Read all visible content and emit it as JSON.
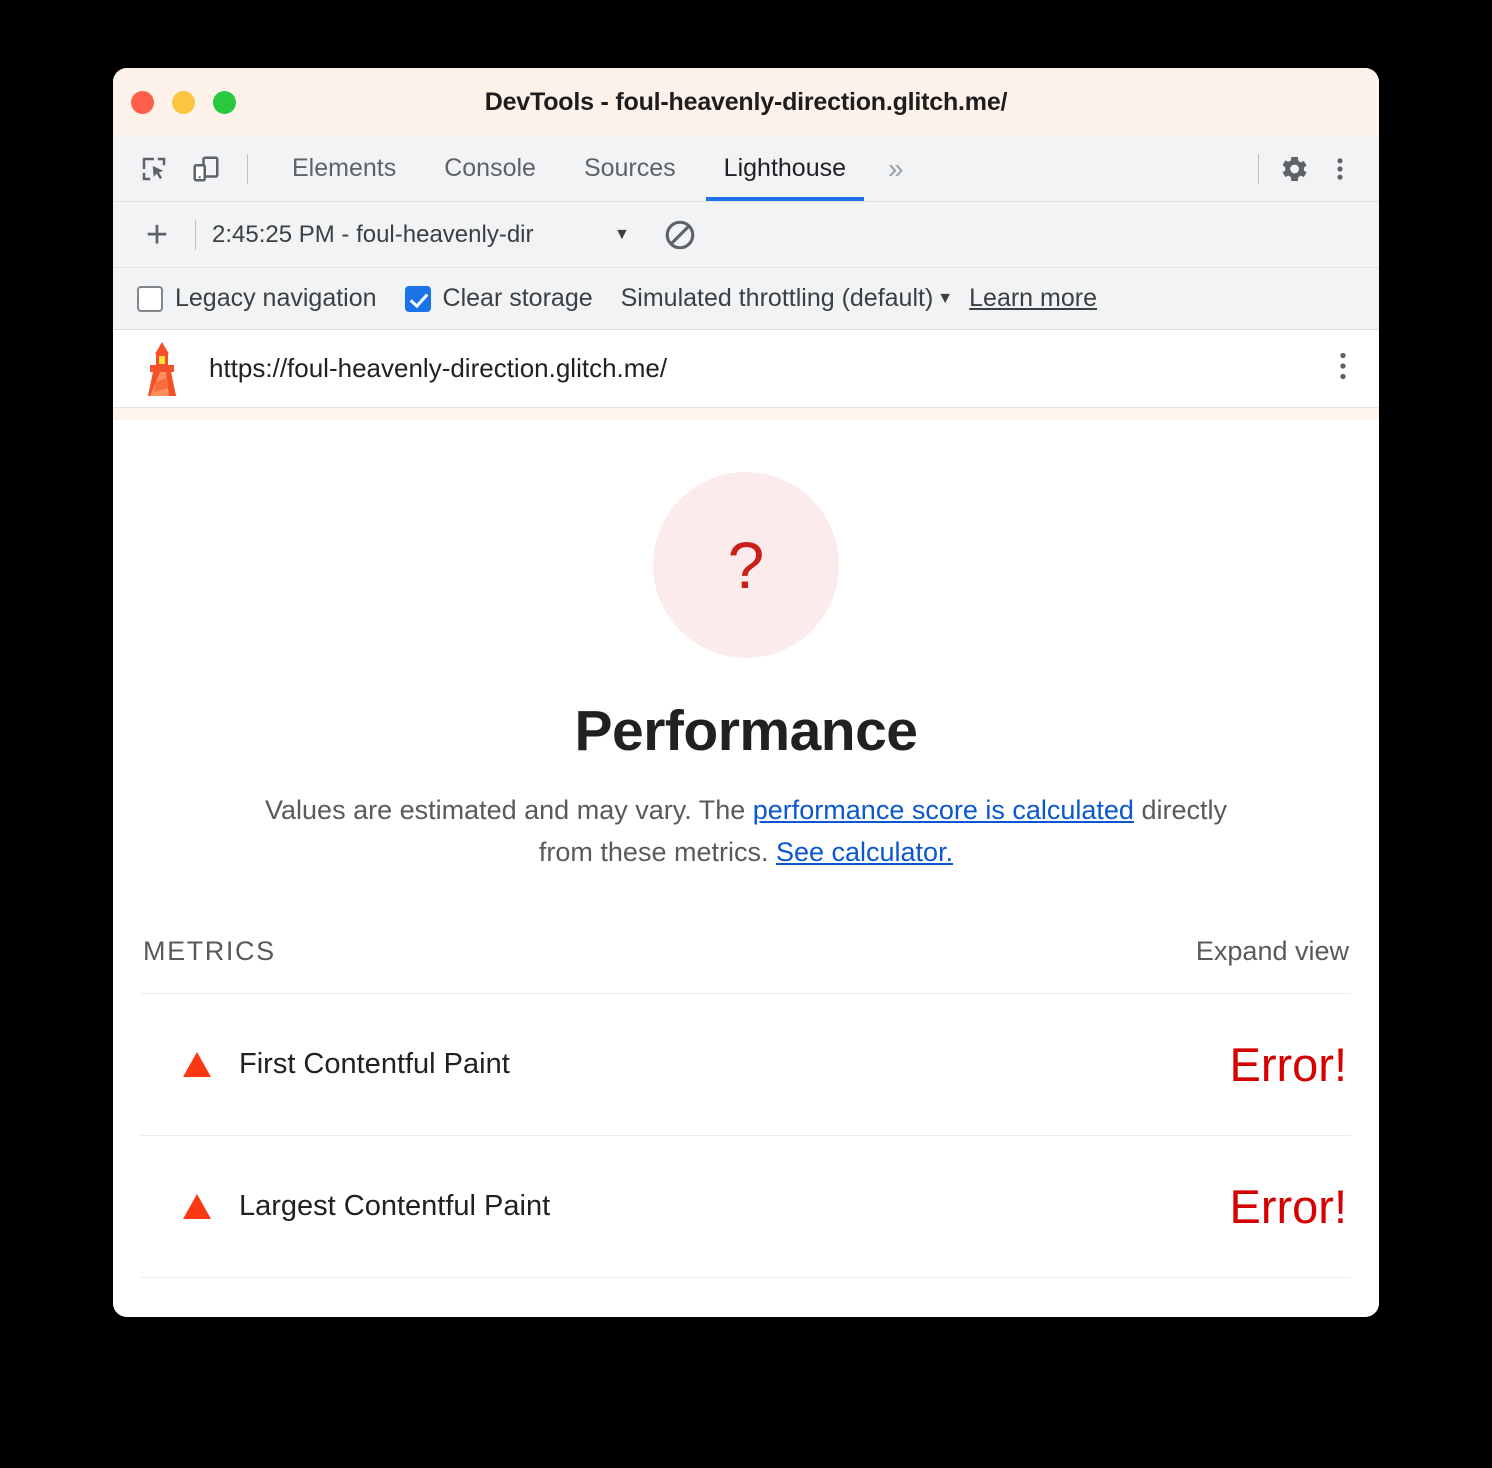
{
  "window": {
    "title": "DevTools - foul-heavenly-direction.glitch.me/",
    "traffic_lights": [
      {
        "name": "close",
        "color": "#ff5f48"
      },
      {
        "name": "minimize",
        "color": "#fcc53f"
      },
      {
        "name": "maximize",
        "color": "#27c93f"
      }
    ]
  },
  "tabbar": {
    "inspect_icon": "inspect-element-icon",
    "device_icon": "device-toolbar-icon",
    "tabs": [
      {
        "label": "Elements",
        "active": false
      },
      {
        "label": "Console",
        "active": false
      },
      {
        "label": "Sources",
        "active": false
      },
      {
        "label": "Lighthouse",
        "active": true
      }
    ],
    "overflow_label": "»",
    "settings_icon": "gear-icon",
    "menu_icon": "kebab-menu-icon",
    "active_underline_color": "#1a73e8"
  },
  "lighthouse_toolbar": {
    "add_label": "+",
    "report_name": "2:45:25 PM - foul-heavenly-dir",
    "caret": "▼",
    "clear_icon": "clear-report-icon"
  },
  "options": {
    "legacy_navigation": {
      "label": "Legacy navigation",
      "checked": false
    },
    "clear_storage": {
      "label": "Clear storage",
      "checked": true
    },
    "throttling": {
      "label": "Simulated throttling (default)",
      "caret": "▼"
    },
    "learn_more": "Learn more"
  },
  "urlbar": {
    "icon": "lighthouse-icon",
    "url": "https://foul-heavenly-direction.glitch.me/",
    "menu_icon": "kebab-menu-icon"
  },
  "report": {
    "gauge": {
      "value": "?",
      "fill_color": "#fcebeb",
      "text_color": "#c9201a"
    },
    "category_title": "Performance",
    "description": {
      "part1": "Values are estimated and may vary. The ",
      "link1": "performance score is calculated",
      "part2": " directly from these metrics. ",
      "link2": "See calculator.",
      "link_color": "#0b57d0"
    },
    "metrics_label": "METRICS",
    "expand_view_label": "Expand view",
    "metrics": [
      {
        "icon": "error-triangle-icon",
        "name": "First Contentful Paint",
        "value": "Error!",
        "value_color": "#d50000"
      },
      {
        "icon": "error-triangle-icon",
        "name": "Largest Contentful Paint",
        "value": "Error!",
        "value_color": "#d50000"
      }
    ]
  }
}
